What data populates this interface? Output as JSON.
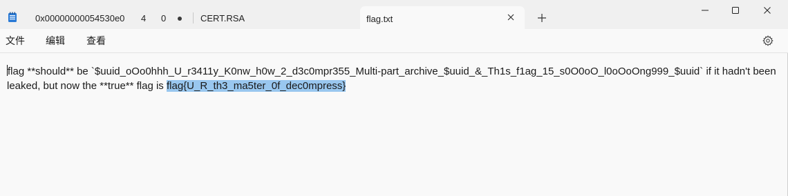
{
  "window": {
    "tabs": [
      {
        "label": "0x00000000054530e0",
        "count_a": "4",
        "count_b": "0",
        "modified": true
      },
      {
        "label": "CERT.RSA"
      },
      {
        "label": "flag.txt",
        "active": true
      }
    ],
    "controls": {
      "minimize_icon": "minimize-icon",
      "maximize_icon": "maximize-icon",
      "close_icon": "close-icon"
    }
  },
  "menu": {
    "file_label": "文件",
    "edit_label": "编辑",
    "view_label": "查看",
    "settings_icon": "gear-icon"
  },
  "editor": {
    "text_before_selection": "flag **should** be `$uuid_oOo0hhh_U_r3411y_K0nw_h0w_2_d3c0mpr355_Multi-part_archive_$uuid_&_Th1s_f1ag_15_s0O0oO_l0oOoOng999_$uuid` if it hadn't been leaked, but now the **true** flag is ",
    "selected_text": "flag{U_R_th3_ma5ter_0f_dec0mpress}",
    "selection_color": "#99c7ef"
  },
  "colors": {
    "titlebar_bg": "#f0f0f0",
    "editor_bg": "#f9f9f9",
    "text": "#1a1a1a"
  }
}
